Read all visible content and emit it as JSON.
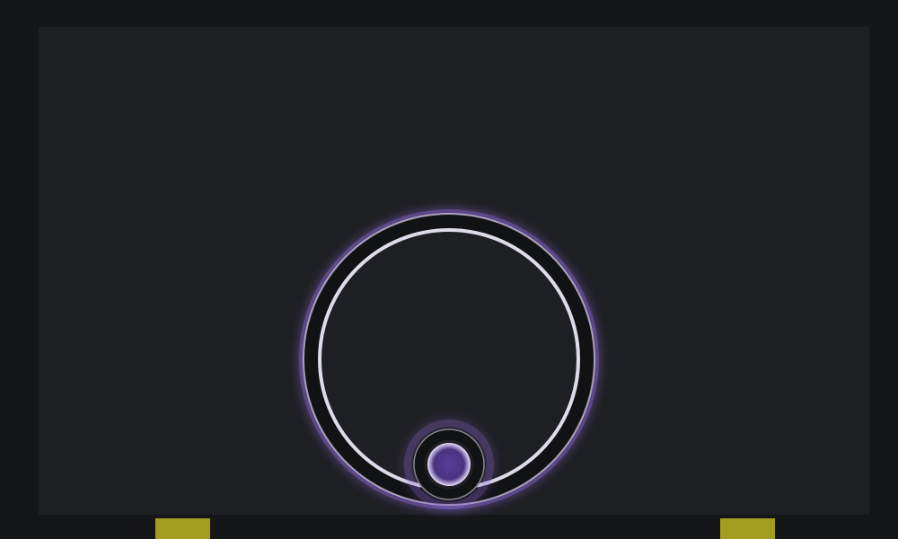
{
  "game": {
    "colors": {
      "outer_background": "#151618",
      "stage_background": "#1e1f23",
      "ring_fill": "#1e1f23",
      "ring_stroke": "#111214",
      "glow": "#7d5cc4",
      "ball_core": "#6a4ab0",
      "pad": "#a39d1e"
    },
    "elements": {
      "ring": "large-ring",
      "ball": "small-ball",
      "pads": [
        "left-pad",
        "right-pad"
      ]
    }
  }
}
